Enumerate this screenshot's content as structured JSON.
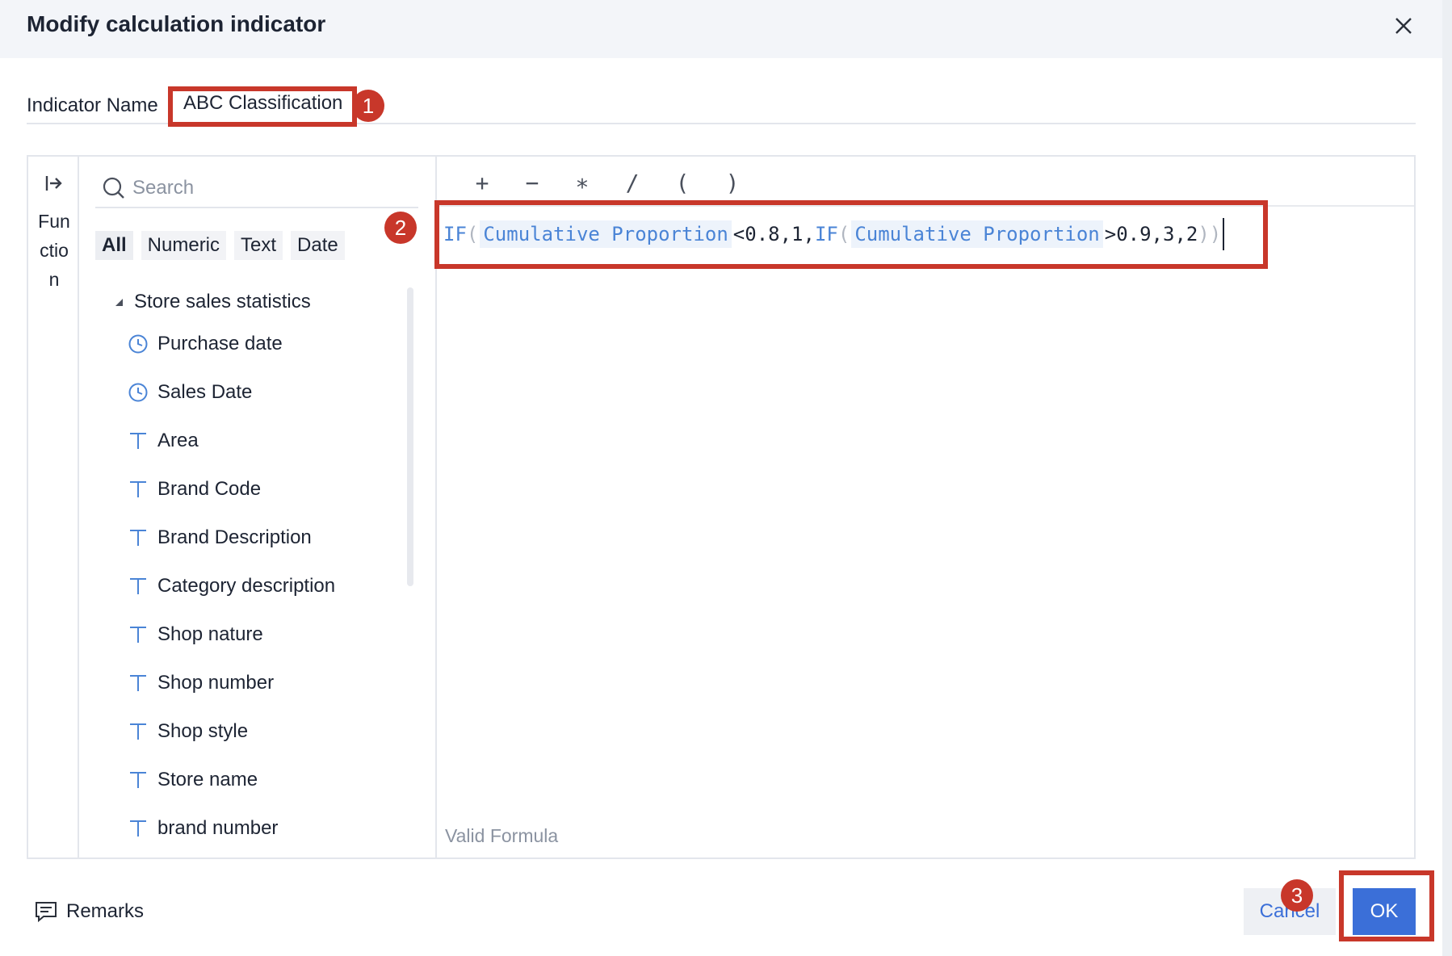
{
  "dialog": {
    "title": "Modify calculation indicator",
    "close_icon": "close-icon"
  },
  "indicator": {
    "label": "Indicator Name",
    "value": "ABC Classification"
  },
  "function_strip": {
    "toggle_icon": "expand-panel-icon",
    "label": "Function"
  },
  "fields": {
    "search_placeholder": "Search",
    "filters": [
      {
        "label": "All",
        "active": true
      },
      {
        "label": "Numeric",
        "active": false
      },
      {
        "label": "Text",
        "active": false
      },
      {
        "label": "Date",
        "active": false
      }
    ],
    "group": "Store sales statistics",
    "items": [
      {
        "label": "Purchase date",
        "icon": "clock-icon"
      },
      {
        "label": "Sales Date",
        "icon": "clock-icon"
      },
      {
        "label": "Area",
        "icon": "text-type-icon"
      },
      {
        "label": "Brand Code",
        "icon": "text-type-icon"
      },
      {
        "label": "Brand Description",
        "icon": "text-type-icon"
      },
      {
        "label": "Category description",
        "icon": "text-type-icon"
      },
      {
        "label": "Shop nature",
        "icon": "text-type-icon"
      },
      {
        "label": "Shop number",
        "icon": "text-type-icon"
      },
      {
        "label": "Shop style",
        "icon": "text-type-icon"
      },
      {
        "label": "Store name",
        "icon": "text-type-icon"
      },
      {
        "label": "brand number",
        "icon": "text-type-icon"
      }
    ]
  },
  "operators": [
    "+",
    "−",
    "∗",
    "/",
    "(",
    ")"
  ],
  "formula": {
    "fn1": "IF",
    "open1": "(",
    "field1": "Cumulative Proportion",
    "mid1": "<0.8,1,",
    "fn2": "IF",
    "open2": "(",
    "field2": "Cumulative Proportion",
    "mid2": ">0.9,3,2",
    "close": "))"
  },
  "validation": "Valid Formula",
  "footer": {
    "remarks": "Remarks",
    "remarks_icon": "comment-icon",
    "cancel": "Cancel",
    "ok": "OK"
  },
  "annotations": [
    "1",
    "2",
    "3"
  ],
  "colors": {
    "accent": "#3b6fd8",
    "annotation": "#c8372a",
    "function": "#4a84d6",
    "header_bg": "#f3f5f9"
  }
}
